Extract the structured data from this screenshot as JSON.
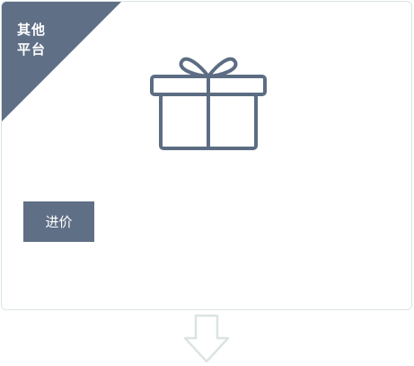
{
  "card": {
    "corner_badge": {
      "line1": "其他",
      "line2": "平台"
    },
    "icon": "gift-icon",
    "button_label": "进价"
  },
  "flow": {
    "next_icon": "down-arrow-icon"
  },
  "colors": {
    "accent": "#5f6f86",
    "card_border": "#dbe3e3",
    "icon_stroke": "#5c6d83",
    "arrow_stroke": "#dce3e3"
  }
}
